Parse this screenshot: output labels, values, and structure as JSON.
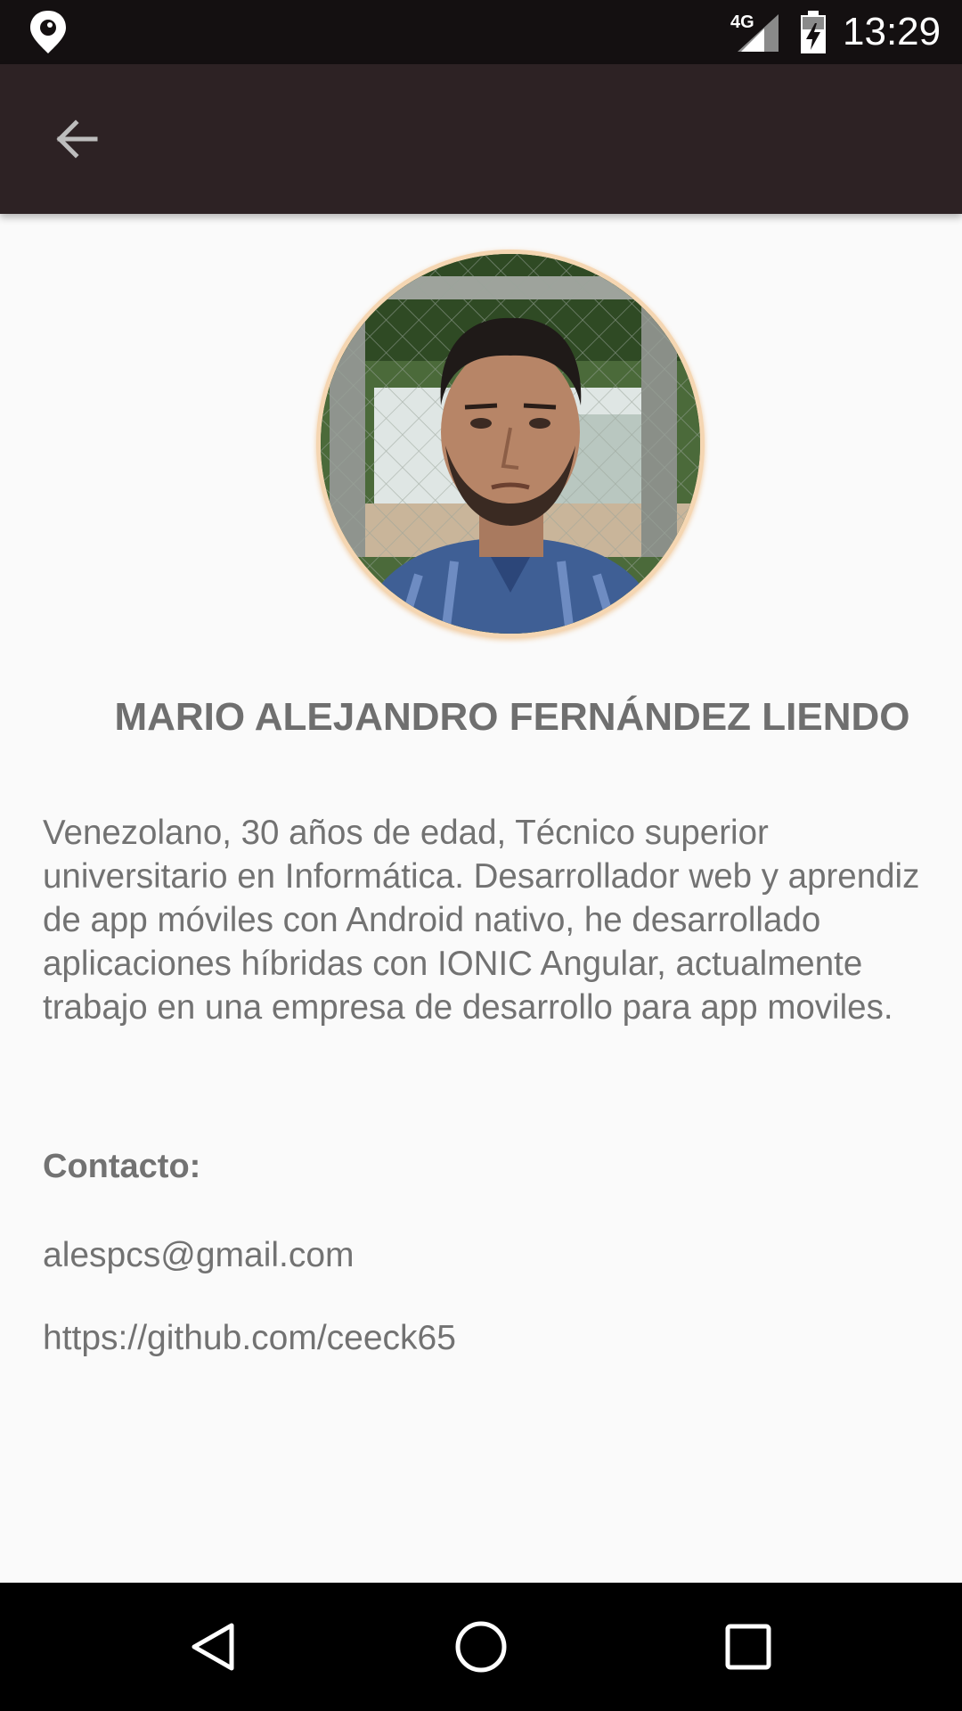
{
  "status_bar": {
    "network": "4G",
    "time": "13:29",
    "icons": [
      "location-pin-icon",
      "signal-icon",
      "battery-icon"
    ]
  },
  "toolbar": {
    "back_icon": "arrow-back-icon"
  },
  "profile": {
    "avatar_icon": "profile-photo",
    "name": "MARIO ALEJANDRO FERNÁNDEZ LIENDO",
    "bio": "Venezolano, 30 años de edad, Técnico superior universitario en Informática. Desarrollador web y aprendiz de app móviles con Android nativo, he desarrollado aplicaciones híbridas con IONIC Angular, actualmente trabajo en una empresa de desarrollo para app moviles.",
    "contact_title": "Contacto:",
    "email": "alespcs@gmail.com",
    "github": "https://github.com/ceeck65"
  },
  "nav_bar": {
    "icons": [
      "back-triangle-icon",
      "home-circle-icon",
      "recents-square-icon"
    ]
  },
  "colors": {
    "status_bar": "#141011",
    "toolbar": "#2d2224",
    "background": "#fafafa",
    "text": "#727272",
    "avatar_border": "#f5d6b2"
  }
}
